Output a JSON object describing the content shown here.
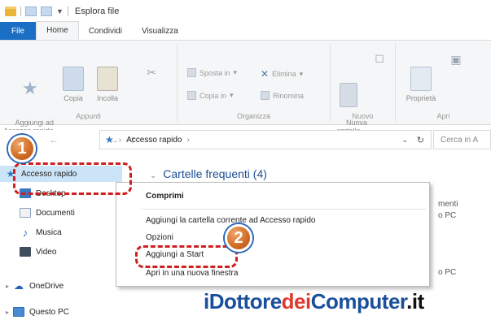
{
  "window": {
    "title": "Esplora file"
  },
  "tabs": [
    "File",
    "Home",
    "Condividi",
    "Visualizza"
  ],
  "ribbon": {
    "appunti": {
      "label": "Appunti",
      "pin": "Aggiungi ad\nAccesso rapido",
      "copy": "Copia",
      "paste": "Incolla"
    },
    "organizza": {
      "label": "Organizza",
      "move": "Sposta in",
      "copyto": "Copia in",
      "delete": "Elimina",
      "rename": "Rinomina"
    },
    "nuovo": {
      "label": "Nuovo",
      "newfolder": "Nuova\ncartella"
    },
    "apri": {
      "label": "Apri",
      "properties": "Proprietà"
    }
  },
  "address": {
    "path": "Accesso rapido",
    "search_placeholder": "Cerca in A"
  },
  "navpane": [
    {
      "label": "Accesso rapido",
      "icon": "quick-access-star-icon"
    },
    {
      "label": "Desktop",
      "icon": "desktop-icon"
    },
    {
      "label": "Documenti",
      "icon": "documents-icon"
    },
    {
      "label": "Musica",
      "icon": "music-icon"
    },
    {
      "label": "Video",
      "icon": "video-icon"
    },
    {
      "label": "OneDrive",
      "icon": "onedrive-icon"
    },
    {
      "label": "Questo PC",
      "icon": "this-pc-icon"
    }
  ],
  "content": {
    "section": "Cartelle frequenti (4)",
    "right1": "menti",
    "right2": "o PC",
    "right3": "o PC"
  },
  "context_menu": {
    "items": [
      "Comprimi",
      "Aggiungi la cartella corrente ad Accesso rapido",
      "Opzioni",
      "Aggiungi a Start",
      "Apri in una nuova finestra"
    ]
  },
  "badges": [
    "1",
    "2"
  ],
  "watermark": {
    "part1": "iDottore",
    "part2": "dei",
    "part3": "Computer",
    "part4": ".it"
  },
  "colors": {
    "accent": "#1a6fc4",
    "highlight": "#cf1f1f",
    "badge": "#d9772e"
  }
}
